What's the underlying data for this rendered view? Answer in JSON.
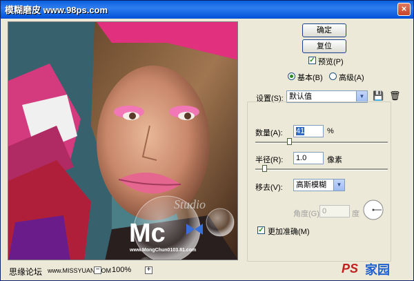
{
  "window": {
    "title": "模糊磨皮  www.98ps.com",
    "close": "×"
  },
  "buttons": {
    "ok": "确定",
    "reset": "复位"
  },
  "preview_toggle": {
    "label": "预览(P)",
    "checked": true
  },
  "mode": {
    "basic": "基本(B)",
    "advanced": "高级(A)",
    "selected": "basic"
  },
  "settings": {
    "label": "设置(S):",
    "value": "默认值"
  },
  "amount": {
    "label": "数量(A):",
    "value": "41",
    "unit": "%",
    "level": 0.41
  },
  "radius": {
    "label": "半径(R):",
    "value": "1.0",
    "unit": "像素",
    "level": 0.02
  },
  "remove": {
    "label": "移去(V):",
    "value": "高斯模糊"
  },
  "angle": {
    "label": "角度(G):",
    "value": "0",
    "unit": "度"
  },
  "more_accurate": {
    "label": "更加准确(M)",
    "checked": true
  },
  "zoom": {
    "minus": "−",
    "plus": "+",
    "level": "100%"
  },
  "watermarks": {
    "forum": "思缘论坛",
    "site": "www.MISSYUAN.COM",
    "logo_main": "Mc",
    "logo_sub": "Studio",
    "logo_url": "www.MongChun0103.81.com",
    "ps_brand": "PS",
    "ps_suffix": "家园"
  },
  "colors": {
    "accent": "#2b8a1f",
    "title_bar": "#0a5fdd",
    "dialog_bg": "#ece9d8"
  }
}
